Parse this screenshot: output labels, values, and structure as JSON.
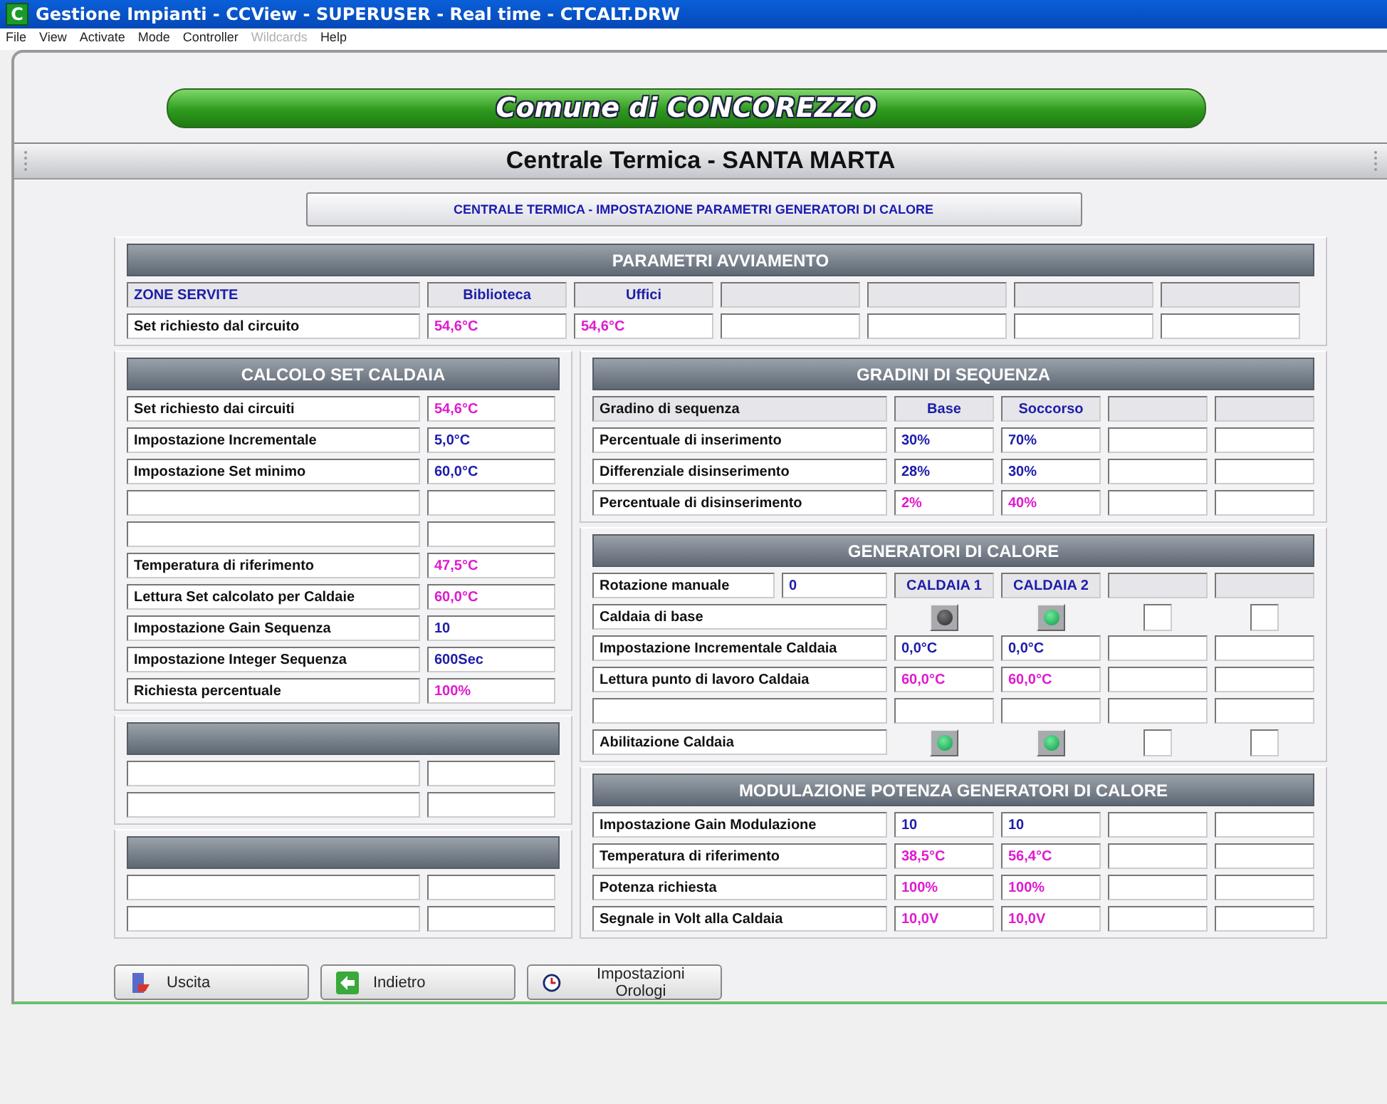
{
  "window": {
    "icon_letter": "C",
    "title": "Gestione Impianti - CCView - SUPERUSER - Real time - CTCALT.DRW"
  },
  "menu": [
    {
      "label": "File",
      "disabled": false
    },
    {
      "label": "View",
      "disabled": false
    },
    {
      "label": "Activate",
      "disabled": false
    },
    {
      "label": "Mode",
      "disabled": false
    },
    {
      "label": "Controller",
      "disabled": false
    },
    {
      "label": "Wildcards",
      "disabled": true
    },
    {
      "label": "Help",
      "disabled": false
    }
  ],
  "banner": "Comune di CONCOREZZO",
  "section_title": "Centrale Termica - SANTA MARTA",
  "header_button": "CENTRALE TERMICA - IMPOSTAZIONE PARAMETRI GENERATORI DI CALORE",
  "avviamento": {
    "title": "PARAMETRI AVVIAMENTO",
    "header": {
      "label": "ZONE SERVITE",
      "columns": [
        "Biblioteca",
        "Uffici"
      ]
    },
    "row": {
      "label": "Set richiesto dal circuito",
      "values": [
        {
          "text": "54,6°C",
          "kind": "reading"
        },
        {
          "text": "54,6°C",
          "kind": "reading"
        }
      ]
    }
  },
  "left_panels": [
    {
      "title": "CALCOLO SET CALDAIA",
      "rows": [
        {
          "kind": "value",
          "label": "Set richiesto dai circuiti",
          "value": {
            "text": "54,6°C",
            "kind": "reading"
          }
        },
        {
          "kind": "value",
          "label": "Impostazione Incrementale",
          "value": {
            "text": "5,0°C",
            "kind": "setting"
          }
        },
        {
          "kind": "value",
          "label": "Impostazione Set minimo",
          "value": {
            "text": "60,0°C",
            "kind": "setting"
          }
        },
        {
          "kind": "blank"
        },
        {
          "kind": "blank"
        },
        {
          "kind": "value",
          "label": "Temperatura di riferimento",
          "value": {
            "text": "47,5°C",
            "kind": "reading"
          }
        },
        {
          "kind": "value",
          "label": "Lettura Set calcolato per Caldaie",
          "value": {
            "text": "60,0°C",
            "kind": "reading"
          }
        },
        {
          "kind": "value",
          "label": "Impostazione Gain Sequenza",
          "value": {
            "text": "10",
            "kind": "setting"
          }
        },
        {
          "kind": "value",
          "label": "Impostazione Integer Sequenza",
          "value": {
            "text": "600Sec",
            "kind": "setting"
          }
        },
        {
          "kind": "value",
          "label": "Richiesta percentuale",
          "value": {
            "text": "100%",
            "kind": "reading"
          }
        }
      ]
    },
    {
      "rows": [
        {
          "kind": "blank"
        },
        {
          "kind": "blank"
        }
      ]
    },
    {
      "rows": [
        {
          "kind": "blank"
        },
        {
          "kind": "blank"
        }
      ]
    }
  ],
  "right_panels": [
    {
      "title": "GRADINI DI SEQUENZA",
      "rows": [
        {
          "kind": "header",
          "label": "Gradino di sequenza",
          "columns": [
            "Base",
            "Soccorso"
          ]
        },
        {
          "kind": "values",
          "label": "Percentuale di inserimento",
          "values": [
            {
              "text": "30%",
              "kind": "setting"
            },
            {
              "text": "70%",
              "kind": "setting"
            }
          ]
        },
        {
          "kind": "values",
          "label": "Differenziale  disinserimento",
          "values": [
            {
              "text": "28%",
              "kind": "setting"
            },
            {
              "text": "30%",
              "kind": "setting"
            }
          ]
        },
        {
          "kind": "values",
          "label": "Percentuale di disinserimento",
          "values": [
            {
              "text": "2%",
              "kind": "reading"
            },
            {
              "text": "40%",
              "kind": "reading"
            }
          ]
        }
      ]
    },
    {
      "title": "GENERATORI DI CALORE",
      "rows": [
        {
          "kind": "header",
          "label": "Rotazione manuale",
          "input": {
            "text": "0",
            "kind": "setting"
          },
          "columns": [
            "CALDAIA 1",
            "CALDAIA 2"
          ]
        },
        {
          "kind": "leds",
          "label": "Caldaia di base",
          "leds": [
            {
              "on": false
            },
            {
              "on": true
            }
          ]
        },
        {
          "kind": "values",
          "label": "Impostazione Incrementale Caldaia",
          "values": [
            {
              "text": "0,0°C",
              "kind": "setting"
            },
            {
              "text": "0,0°C",
              "kind": "setting"
            }
          ]
        },
        {
          "kind": "values",
          "label": "Lettura punto di lavoro Caldaia",
          "values": [
            {
              "text": "60,0°C",
              "kind": "reading"
            },
            {
              "text": "60,0°C",
              "kind": "reading"
            }
          ]
        },
        {
          "kind": "blank"
        },
        {
          "kind": "leds",
          "label": "Abilitazione Caldaia",
          "leds": [
            {
              "on": true
            },
            {
              "on": true
            }
          ]
        }
      ]
    },
    {
      "title": "MODULAZIONE POTENZA GENERATORI DI CALORE",
      "rows": [
        {
          "kind": "values",
          "label": "Impostazione Gain Modulazione",
          "values": [
            {
              "text": "10",
              "kind": "setting"
            },
            {
              "text": "10",
              "kind": "setting"
            }
          ]
        },
        {
          "kind": "values",
          "label": "Temperatura di riferimento",
          "values": [
            {
              "text": "38,5°C",
              "kind": "reading"
            },
            {
              "text": "56,4°C",
              "kind": "reading"
            }
          ]
        },
        {
          "kind": "values",
          "label": "Potenza richiesta",
          "values": [
            {
              "text": "100%",
              "kind": "reading"
            },
            {
              "text": "100%",
              "kind": "reading"
            }
          ]
        },
        {
          "kind": "values",
          "label": "Segnale in Volt alla Caldaia",
          "values": [
            {
              "text": "10,0V",
              "kind": "reading"
            },
            {
              "text": "10,0V",
              "kind": "reading"
            }
          ]
        }
      ]
    }
  ],
  "buttons": [
    {
      "label": "Uscita"
    },
    {
      "label": "Indietro"
    },
    {
      "label": "Impostazioni Orologi"
    }
  ]
}
